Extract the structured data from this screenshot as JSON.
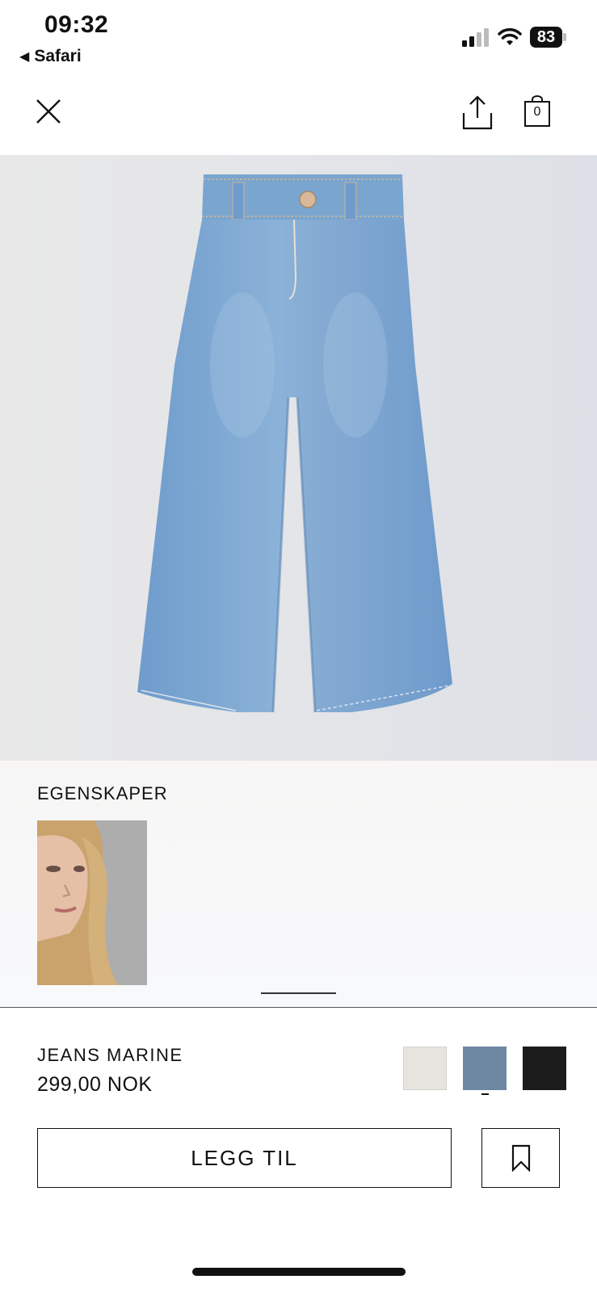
{
  "status_bar": {
    "time": "09:32",
    "back_app": "Safari",
    "battery": "83",
    "icons": [
      "signal-icon",
      "wifi-icon",
      "battery-icon"
    ]
  },
  "nav": {
    "icons": [
      "close-icon",
      "share-icon",
      "shopping-bag-icon"
    ],
    "bag_count": "0"
  },
  "features": {
    "title": "EGENSKAPER"
  },
  "product": {
    "name": "JEANS MARINE",
    "price": "299,00 NOK",
    "colors": [
      {
        "name": "ecru",
        "hex": "#e7e3de"
      },
      {
        "name": "blue",
        "hex": "#6e88a4",
        "selected": true
      },
      {
        "name": "black",
        "hex": "#1c1c1c"
      }
    ]
  },
  "actions": {
    "add_label": "LEGG TIL",
    "save_icon": "bookmark-icon"
  }
}
